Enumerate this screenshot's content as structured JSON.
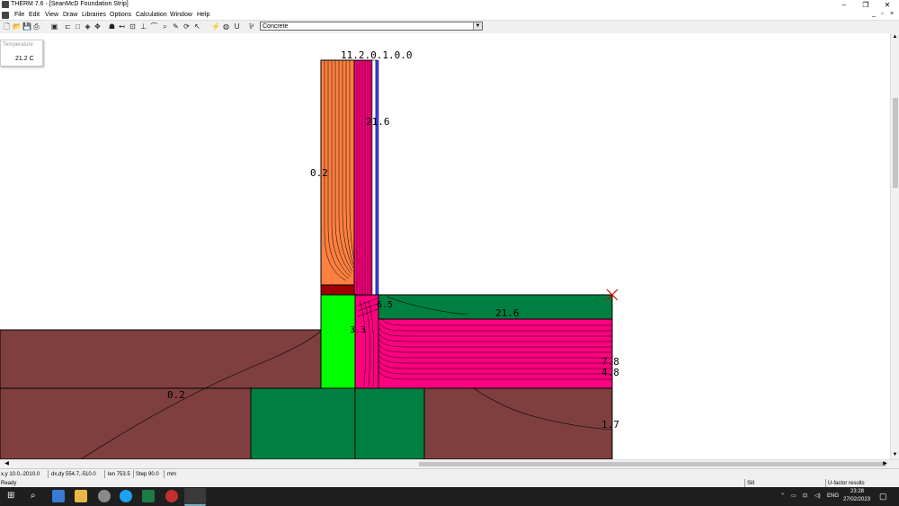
{
  "window": {
    "title": "THERM 7.6 - [SeanMcD Foundation Strip]",
    "min_glyph": "–",
    "max_glyph": "❐",
    "close_glyph": "✕"
  },
  "menu": {
    "items": [
      "File",
      "Edit",
      "View",
      "Draw",
      "Libraries",
      "Options",
      "Calculation",
      "Window",
      "Help"
    ]
  },
  "toolbar": {
    "material": "Concrete"
  },
  "temperature_box": {
    "header": "Temperature",
    "value": "21.2 C"
  },
  "canvas_labels": {
    "top_cluster": "11.2.0.1.0.0",
    "wall_interior": "21.6",
    "wall_left": "0.2",
    "slab_top": "21.6",
    "junction_1": "6.5",
    "junction_2": "3.3",
    "slab_right_1": "7.8",
    "slab_right_2": "4.8",
    "ground_left": "0.2",
    "ground_right": "1.7"
  },
  "status": {
    "xy": "x,y 10.0,-2010.0",
    "dxdy": "dx,dy 554.7,-510.0",
    "len": "len 753.5",
    "step": "Step 90.0",
    "unit": "mm",
    "ready": "Ready",
    "mode": "Sill",
    "ufactor": "U-factor results"
  },
  "taskbar": {
    "lang": "ENG",
    "time": "23:28",
    "date": "27/02/2023"
  },
  "colors": {
    "ground": "#7f3f3f",
    "insulation_orange": "#ff8040",
    "insulation_pink": "#ff0080",
    "concrete_green": "#008040",
    "bright_green": "#00ff00",
    "dark_red": "#a00000",
    "blue_layer": "#4040ff"
  }
}
